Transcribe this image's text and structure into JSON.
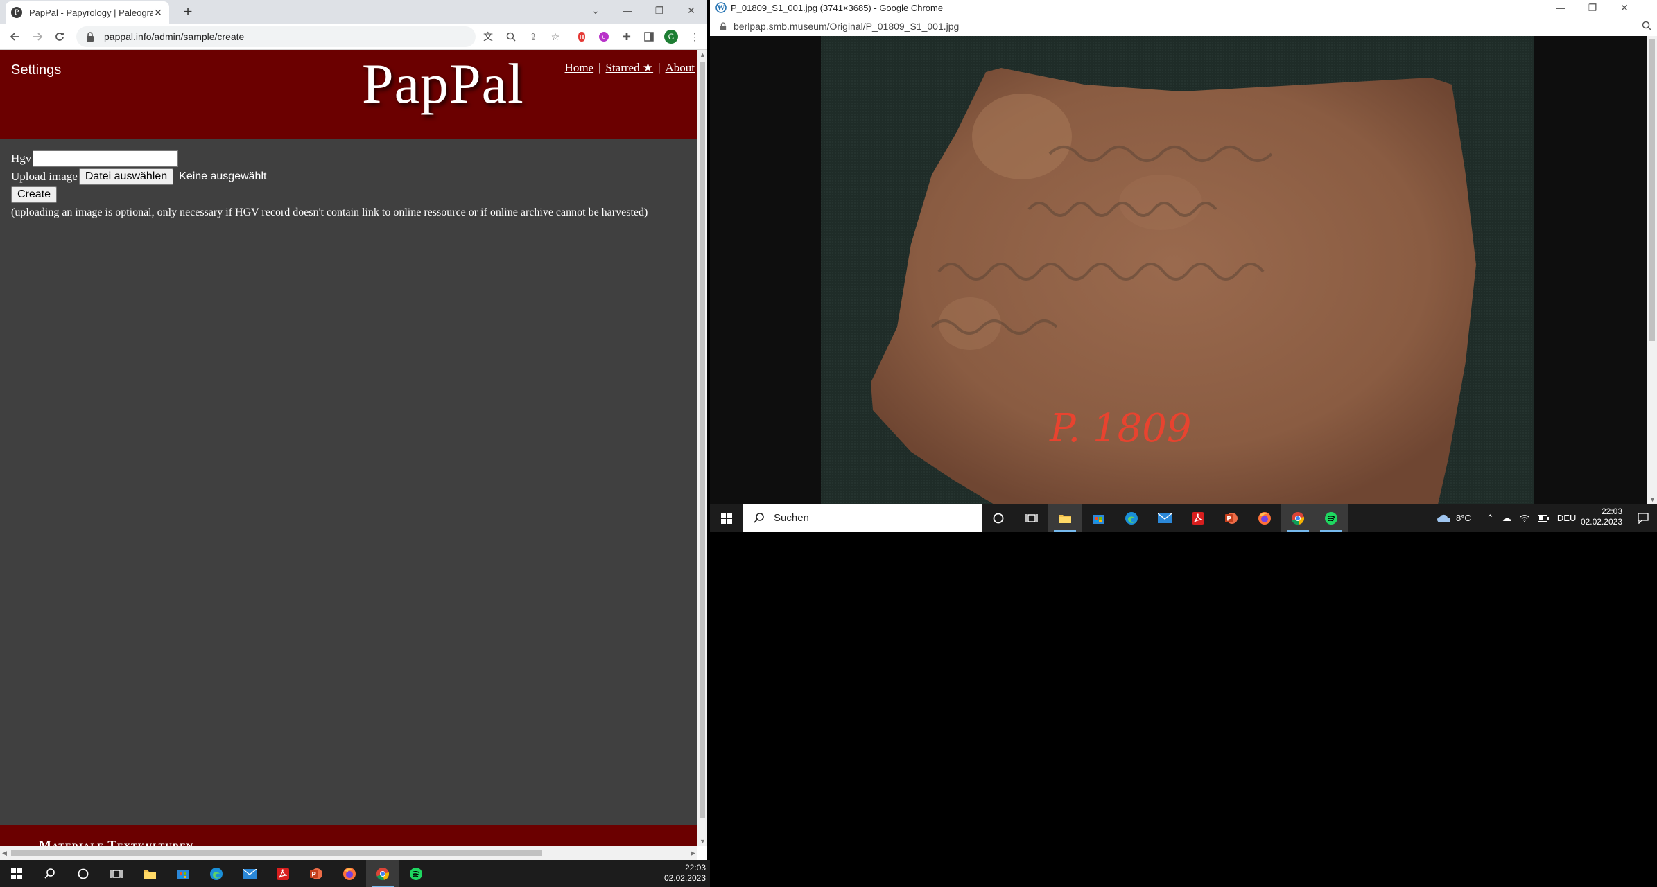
{
  "left_window": {
    "tab_title": "PapPal - Papyrology | Paleograph",
    "url": "pappal.info/admin/sample/create",
    "profile_initial": "C"
  },
  "pappal": {
    "settings_label": "Settings",
    "logo_text": "PapPal",
    "nav": {
      "home": "Home",
      "starred": "Starred ★",
      "about": "About",
      "separator": "|"
    },
    "form": {
      "hgv_label": "Hgv",
      "hgv_value": "",
      "upload_label": "Upload image",
      "file_button": "Datei auswählen",
      "file_status": "Keine ausgewählt",
      "create_button": "Create",
      "hint": "(uploading an image is optional, only necessary if HGV record doesn't contain link to online ressource or if online archive cannot be harvested)"
    },
    "footer_text": "Materiale Textkulturen"
  },
  "right_window": {
    "title": "P_01809_S1_001.jpg (3741×3685) - Google Chrome",
    "url": "berlpap.smb.museum/Original/P_01809_S1_001.jpg",
    "image_label": "P. 1809"
  },
  "taskbar_left": {
    "time": "22:03",
    "date": "02.02.2023"
  },
  "taskbar_right": {
    "search_placeholder": "Suchen",
    "weather": "8°C",
    "language": "DEU",
    "time": "22:03",
    "date": "02.02.2023"
  },
  "colors": {
    "header_red": "#6b0000",
    "page_bg": "#404040",
    "taskbar": "#1c1c1c"
  }
}
